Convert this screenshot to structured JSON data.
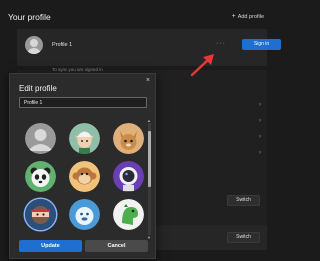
{
  "header": {
    "title": "Your profile",
    "add_label": "Add profile"
  },
  "profile_card": {
    "name": "Profile 1",
    "more_label": "···",
    "signin_label": "Sign in",
    "sync_text": "To sync you are signed in"
  },
  "list": {
    "switch_label": "Switch"
  },
  "dialog": {
    "title": "Edit profile",
    "close_label": "×",
    "name_value": "Profile 1",
    "update_label": "Update",
    "cancel_label": "Cancel",
    "avatars": [
      "default-person",
      "elf-character",
      "cat",
      "panda",
      "monkey",
      "astronaut",
      "ninja",
      "yeti",
      "dinosaur"
    ],
    "selected_avatar": "ninja"
  },
  "colors": {
    "accent": "#1e6fd0",
    "annotation_arrow": "#e8373a"
  }
}
